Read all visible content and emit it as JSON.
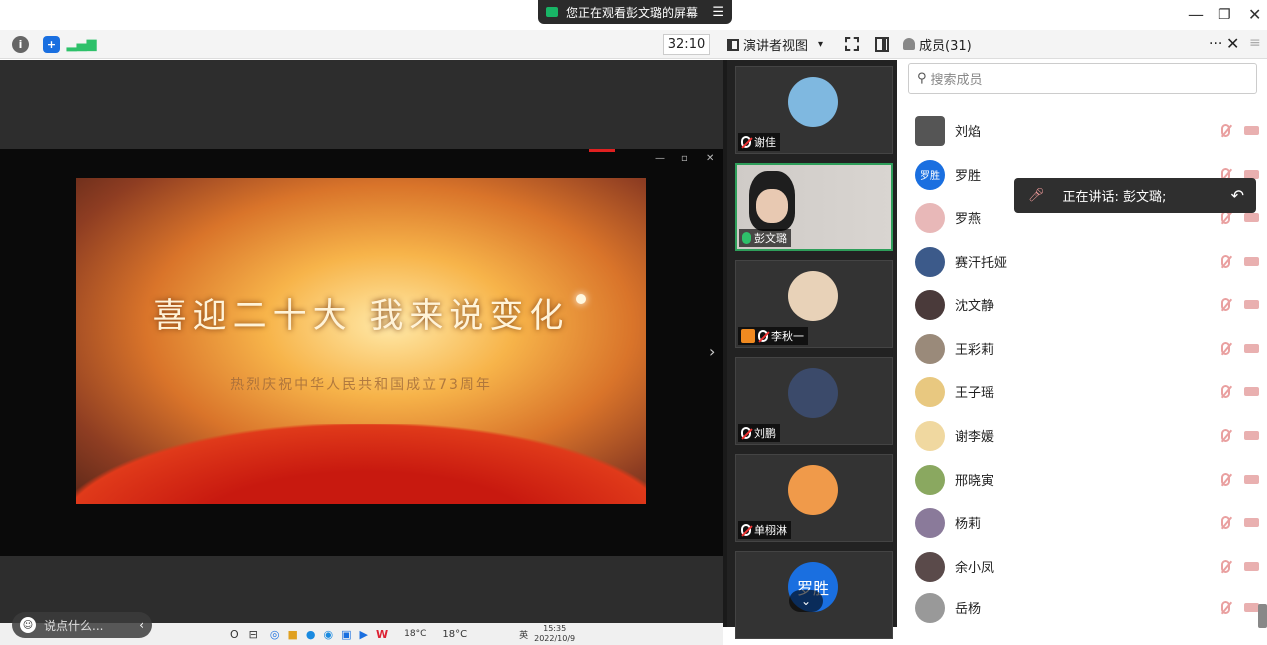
{
  "window": {
    "share_banner": "您正在观看彭文璐的屏幕",
    "share_menu_icon": "menu-icon",
    "minimize": "—",
    "restore": "❐",
    "close": "✕"
  },
  "toolbar": {
    "info_icon": "info-icon",
    "shield_icon": "shield-icon",
    "signal_icon": "signal-icon",
    "timer": "32:10",
    "view_label": "演讲者视图",
    "view_caret": "▾",
    "fullscreen_icon": "fullscreen-icon",
    "panel_icon": "panel-toggle-icon"
  },
  "shared_screen": {
    "slide_title": "喜迎二十大   我来说变化",
    "slide_subtitle": "热烈庆祝中华人民共和国成立73周年",
    "taskbar": {
      "weather1": "18°C",
      "weather2": "18°C",
      "lang": "英",
      "time": "15:35",
      "date": "2022/10/9"
    },
    "chat_placeholder": "说点什么...",
    "chat_arrow": "‹",
    "next_arrow": "›"
  },
  "gallery": {
    "tiles": [
      {
        "name": "谢佳",
        "avatar_color": "#7fb8e0",
        "mic": "off"
      },
      {
        "name": "彭文璐",
        "avatar_color": "#d7d3cf",
        "mic": "on"
      },
      {
        "name": "李秋一",
        "avatar_color": "#e8d2b8",
        "mic": "off"
      },
      {
        "name": "刘鹏",
        "avatar_color": "#3b4a6a",
        "mic": "off"
      },
      {
        "name": "单栩淋",
        "avatar_color": "#f09a4a",
        "mic": "off"
      },
      {
        "name": "罗胜",
        "avatar_color": "#1a6fe0",
        "mic": "off",
        "avatar_text": "罗胜"
      }
    ],
    "scroll_down": "⌄"
  },
  "members": {
    "title": "成员(31)",
    "more": "···",
    "close": "✕",
    "menu": "≡",
    "search_placeholder": "搜索成员",
    "list": [
      {
        "name": "刘焰",
        "color": "#555"
      },
      {
        "name": "罗胜",
        "color": "#1a6fe0",
        "avatar_text": "罗胜"
      },
      {
        "name": "罗燕",
        "color": "#e8b8b8"
      },
      {
        "name": "赛汗托娅",
        "color": "#3c5a8a"
      },
      {
        "name": "沈文静",
        "color": "#4a3a3a"
      },
      {
        "name": "王彩莉",
        "color": "#9a8a7a"
      },
      {
        "name": "王子瑶",
        "color": "#e8c880"
      },
      {
        "name": "谢李媛",
        "color": "#f0d8a0"
      },
      {
        "name": "邢晓寅",
        "color": "#8aa860"
      },
      {
        "name": "杨莉",
        "color": "#8a7a9a"
      },
      {
        "name": "余小凤",
        "color": "#5a4a4a"
      },
      {
        "name": "岳杨",
        "color": "#999"
      }
    ]
  },
  "speaking_toast": {
    "text": "正在讲话: 彭文璐;",
    "back": "↶"
  }
}
